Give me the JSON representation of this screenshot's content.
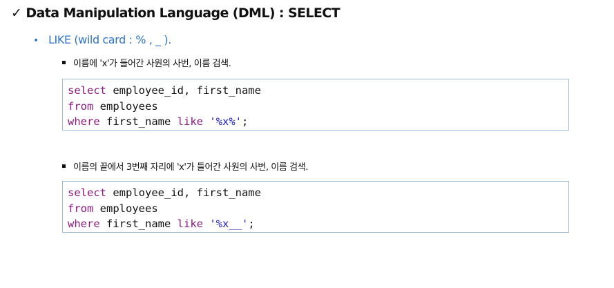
{
  "heading": {
    "check": "✓",
    "title": "Data Manipulation Language (DML) : SELECT"
  },
  "subheading": {
    "bullet": "•",
    "text": "LIKE (wild card : % , _ )."
  },
  "examples": [
    {
      "description": "이름에 'x'가 들어간 사원의 사번, 이름 검색.",
      "code": {
        "line1": {
          "kw": "select",
          "rest": " employee_id, first_name"
        },
        "line2": {
          "kw": "from",
          "rest": " employees"
        },
        "line3": {
          "kw1": "where",
          "mid": " first_name ",
          "kw2": "like",
          "sp": " ",
          "str": "'%x%'",
          "end": ";"
        }
      }
    },
    {
      "description": "이름의 끝에서 3번째 자리에 'x'가 들어간 사원의 사번, 이름 검색.",
      "code": {
        "line1": {
          "kw": "select",
          "rest": " employee_id, first_name"
        },
        "line2": {
          "kw": "from",
          "rest": " employees"
        },
        "line3": {
          "kw1": "where",
          "mid": " first_name ",
          "kw2": "like",
          "sp": " ",
          "str": "'%x__'",
          "end": ";"
        }
      }
    }
  ],
  "colors": {
    "subheading": "#2f74c7",
    "keyword": "#8a1a7e",
    "string": "#2323c9",
    "code_border": "#9dbbd8"
  }
}
